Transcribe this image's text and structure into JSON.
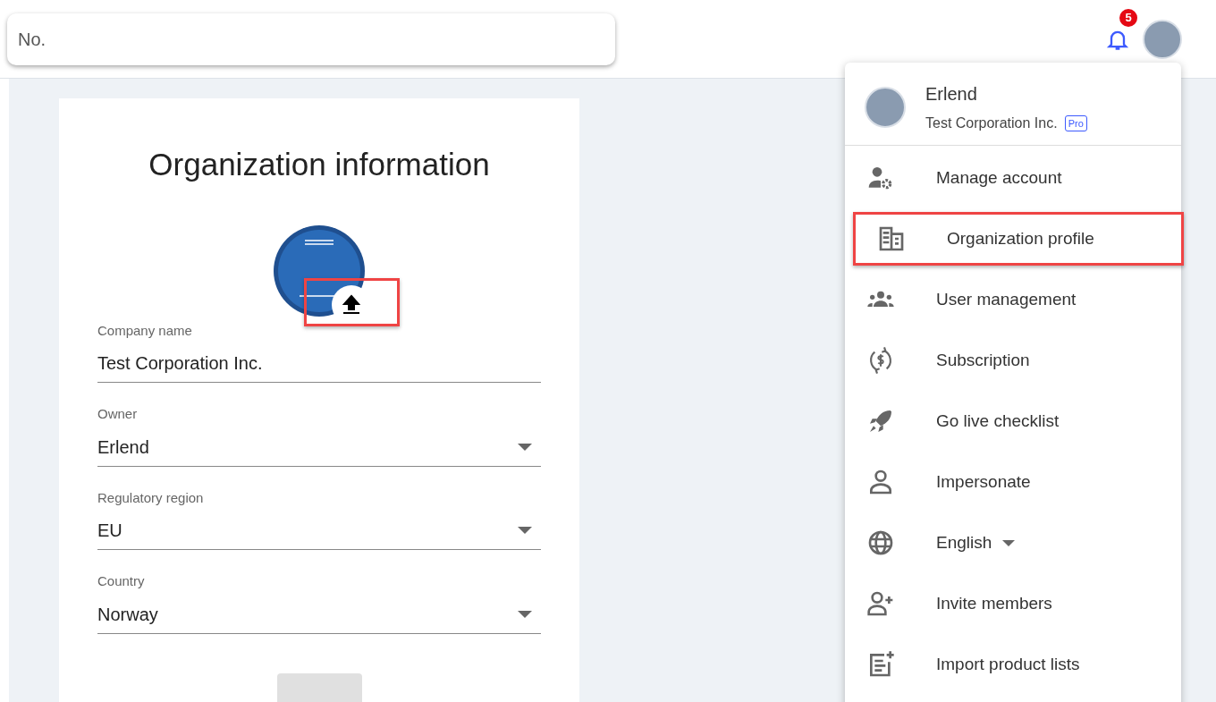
{
  "search": {
    "placeholder": "No."
  },
  "notifications": {
    "count": "5"
  },
  "form": {
    "title": "Organization information",
    "logo_upload": {
      "highlighted": true
    },
    "fields": [
      {
        "kind": "text",
        "label": "Company name",
        "value": "Test Corporation Inc."
      },
      {
        "kind": "select",
        "label": "Owner",
        "value": "Erlend"
      },
      {
        "kind": "select",
        "label": "Regulatory region",
        "value": "EU"
      },
      {
        "kind": "select",
        "label": "Country",
        "value": "Norway"
      }
    ],
    "save_button": {
      "disabled": true
    }
  },
  "account_menu": {
    "user": {
      "name": "Erlend",
      "organization": "Test Corporation Inc.",
      "plan": "Pro"
    },
    "items": [
      {
        "kind": "manage",
        "label": "Manage account",
        "highlighted": false
      },
      {
        "kind": "organization",
        "label": "Organization profile",
        "highlighted": true
      },
      {
        "kind": "users",
        "label": "User management",
        "highlighted": false
      },
      {
        "kind": "subscription",
        "label": "Subscription",
        "highlighted": false
      },
      {
        "kind": "rocket",
        "label": "Go live checklist",
        "highlighted": false
      },
      {
        "kind": "person",
        "label": "Impersonate",
        "highlighted": false
      },
      {
        "kind": "language",
        "label": "English",
        "highlighted": false
      },
      {
        "kind": "invite",
        "label": "Invite members",
        "highlighted": false
      },
      {
        "kind": "import",
        "label": "Import product lists",
        "highlighted": false
      }
    ]
  }
}
